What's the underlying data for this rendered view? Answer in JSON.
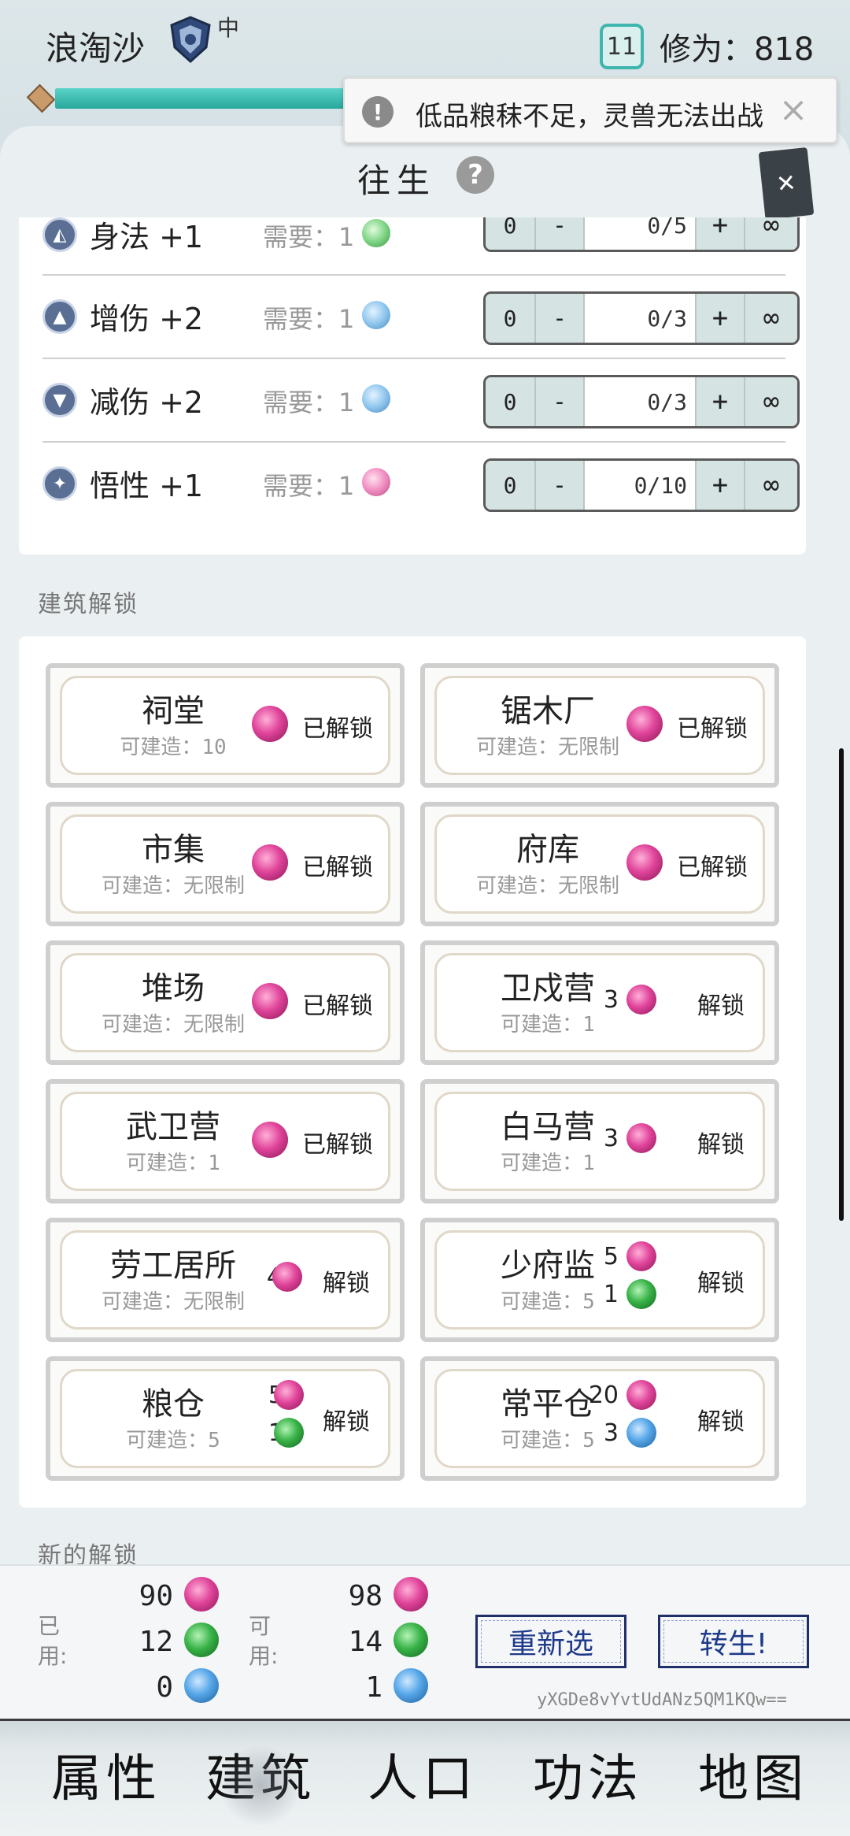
{
  "header": {
    "player_name": "浪淘沙",
    "rank_tier": "中",
    "level": "11",
    "cultivation": "修为：818",
    "progress": 0.95
  },
  "toast": {
    "message": "低品粮秣不足，灵兽无法出战"
  },
  "main": {
    "title": "往生"
  },
  "attributes": [
    {
      "label": "身法 +1",
      "need": "需要：1",
      "orb": "green",
      "value": "0/5"
    },
    {
      "label": "增伤 +2",
      "need": "需要：1",
      "orb": "blue",
      "value": "0/3"
    },
    {
      "label": "减伤 +2",
      "need": "需要：1",
      "orb": "blue",
      "value": "0/3"
    },
    {
      "label": "悟性 +1",
      "need": "需要：1",
      "orb": "pink",
      "value": "0/10"
    }
  ],
  "stepper": {
    "zero": "0",
    "minus": "-",
    "plus": "+",
    "infinity": "∞"
  },
  "sections": {
    "buildings": "建筑解锁",
    "new_unlock": "新的解锁"
  },
  "buildings": [
    {
      "name": "祠堂",
      "sub": "可建造：10",
      "status": "已解锁"
    },
    {
      "name": "锯木厂",
      "sub": "可建造：无限制",
      "status": "已解锁"
    },
    {
      "name": "市集",
      "sub": "可建造：无限制",
      "status": "已解锁"
    },
    {
      "name": "府库",
      "sub": "可建造：无限制",
      "status": "已解锁"
    },
    {
      "name": "堆场",
      "sub": "可建造：无限制",
      "status": "已解锁"
    },
    {
      "name": "卫戍营",
      "sub": "可建造：1",
      "status": "解锁",
      "cost1": "3"
    },
    {
      "name": "武卫营",
      "sub": "可建造：1",
      "status": "已解锁"
    },
    {
      "name": "白马营",
      "sub": "可建造：1",
      "status": "解锁",
      "cost1": "3"
    },
    {
      "name": "劳工居所",
      "sub": "可建造：无限制",
      "status": "解锁",
      "cost1": "4"
    },
    {
      "name": "少府监",
      "sub": "可建造：5",
      "status": "解锁",
      "cost1": "5",
      "cost2": "1"
    },
    {
      "name": "粮仓",
      "sub": "可建造：5",
      "status": "解锁",
      "cost1": "5",
      "cost2": "1"
    },
    {
      "name": "常平仓",
      "sub": "可建造：5",
      "status": "解锁",
      "cost1": "20",
      "cost2": "3"
    }
  ],
  "resources": {
    "used_label": "已用:",
    "avail_label": "可用:",
    "used": [
      "90",
      "12",
      "0"
    ],
    "avail": [
      "98",
      "14",
      "1"
    ]
  },
  "actions": {
    "reselect": "重新选",
    "rebirth": "转生!"
  },
  "save_code": "yXGDe8vYvtUdANz5QM1KQw==",
  "nav": [
    {
      "label": "属性"
    },
    {
      "label": "建筑"
    },
    {
      "label": "人口"
    },
    {
      "label": "功法"
    },
    {
      "label": "地图"
    }
  ]
}
